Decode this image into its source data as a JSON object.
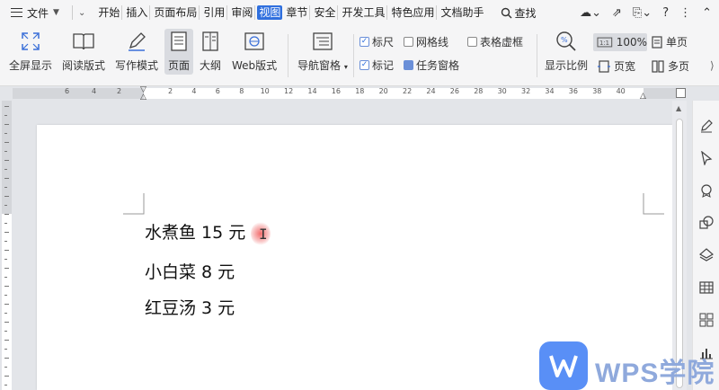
{
  "menubar": {
    "file_label": "文件",
    "tabs": [
      "开始",
      "插入",
      "页面布局",
      "引用",
      "审阅",
      "视图",
      "章节",
      "安全",
      "开发工具",
      "特色应用",
      "文档助手"
    ],
    "active_tab": "视图",
    "search_label": "查找",
    "help_label": "?"
  },
  "toolbar": {
    "fullscreen": "全屏显示",
    "reading": "阅读版式",
    "writing": "写作模式",
    "page": "页面",
    "outline": "大纲",
    "web": "Web版式",
    "navpane": "导航窗格",
    "checkboxes": {
      "ruler": {
        "label": "标尺",
        "checked": true
      },
      "gridlines": {
        "label": "网格线",
        "checked": false
      },
      "table_gridlines": {
        "label": "表格虚框",
        "checked": false
      },
      "marks": {
        "label": "标记",
        "checked": true
      },
      "taskpane": {
        "label": "任务窗格",
        "checked": true
      }
    },
    "zoom_ratio": "显示比例",
    "zoom_value": "100%",
    "single_page": "单页",
    "page_width": "页宽",
    "multi_page": "多页"
  },
  "ruler": {
    "left_ticks": [
      "6",
      "4",
      "2"
    ],
    "right_ticks": [
      "2",
      "4",
      "6",
      "8",
      "10",
      "12",
      "14",
      "16",
      "18",
      "20",
      "22",
      "24",
      "26",
      "28",
      "30",
      "32",
      "34",
      "36",
      "38",
      "40"
    ]
  },
  "document": {
    "lines": [
      "水煮鱼 15 元",
      "小白菜 8 元",
      "红豆汤 3 元"
    ]
  },
  "watermark": {
    "text": "WPS学院"
  },
  "colors": {
    "accent": "#2f6fde",
    "watermark_blue": "#3d7cf5"
  }
}
